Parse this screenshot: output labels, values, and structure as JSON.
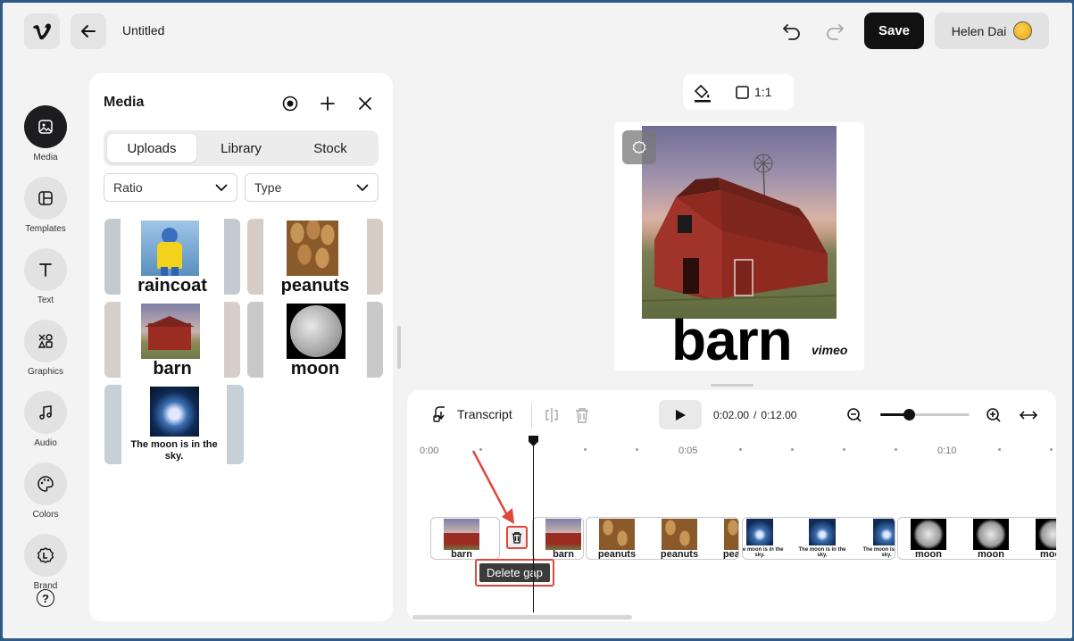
{
  "header": {
    "title": "Untitled",
    "save_label": "Save",
    "user_name": "Helen Dai"
  },
  "sidebar": {
    "items": [
      {
        "label": "Media",
        "icon": "image-icon",
        "active": true
      },
      {
        "label": "Templates",
        "icon": "layout-icon"
      },
      {
        "label": "Text",
        "icon": "text-icon"
      },
      {
        "label": "Graphics",
        "icon": "shapes-icon"
      },
      {
        "label": "Audio",
        "icon": "music-icon"
      },
      {
        "label": "Colors",
        "icon": "palette-icon"
      },
      {
        "label": "Brand",
        "icon": "brand-icon"
      }
    ],
    "help_label": "?"
  },
  "media_panel": {
    "title": "Media",
    "tabs": [
      "Uploads",
      "Library",
      "Stock"
    ],
    "active_tab": "Uploads",
    "ratio_label": "Ratio",
    "type_label": "Type",
    "thumbnails": [
      {
        "label": "raincoat"
      },
      {
        "label": "peanuts"
      },
      {
        "label": "barn"
      },
      {
        "label": "moon"
      },
      {
        "label": "The moon is in the sky."
      }
    ]
  },
  "canvas": {
    "ratio_label": "1:1",
    "caption": "barn",
    "watermark": "vimeo"
  },
  "timeline": {
    "transcript_label": "Transcript",
    "current_time": "0:02.00",
    "separator": "/",
    "total_time": "0:12.00",
    "zoom_level": 0.32,
    "time_labels": [
      "0:00",
      "0:05",
      "0:10"
    ],
    "tooltip": "Delete gap",
    "clips": [
      {
        "label": "barn"
      },
      {
        "label": "barn"
      },
      {
        "label": "peanuts"
      },
      {
        "label": "The moon is in the sky."
      },
      {
        "label": "moon"
      }
    ]
  },
  "colors": {
    "accent_dark": "#1d1d1f",
    "highlight_red": "#e0463c",
    "barn_red": "#9b2c22"
  }
}
